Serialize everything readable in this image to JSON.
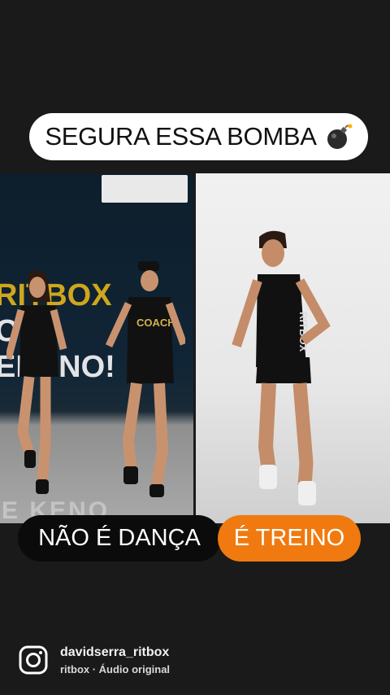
{
  "story": {
    "title": "SEGURA ESSA BOMBA",
    "title_emoji_icon": "bomb-icon",
    "left_panel": {
      "wall_line1": "RITBOX",
      "wall_line2": "O E",
      "wall_line3": "ERENO!",
      "floor_text": "E KENO"
    },
    "right_panel": {
      "shirt_text": "RITBOX"
    },
    "tag_left": "NÃO É DANÇA",
    "tag_right": "É TREINO",
    "accent_color": "#f07a0f"
  },
  "attribution": {
    "icon": "instagram-icon",
    "username": "davidserra_ritbox",
    "audio": "ritbox · Áudio original"
  }
}
